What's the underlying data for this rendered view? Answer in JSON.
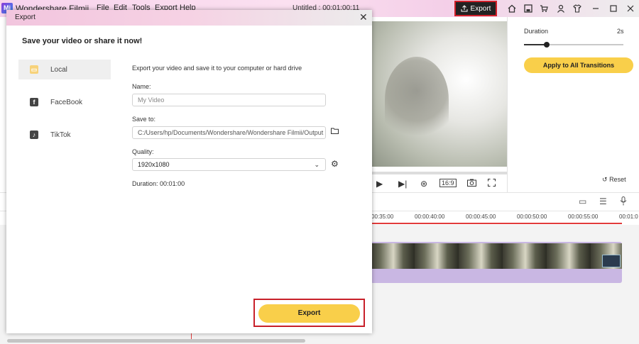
{
  "app": {
    "logo_text": "Mi",
    "name": "Wondershare Filmii",
    "menu": [
      "File",
      "Edit",
      "Tools",
      "Export",
      "Help"
    ],
    "doc_title": "Untitled : 00:01:00:11",
    "export_label": "Export"
  },
  "right_panel": {
    "duration_label": "Duration",
    "duration_value": "2s",
    "duration_fraction": 0.23,
    "apply_label": "Apply to All Transitions",
    "reset_label": "Reset"
  },
  "preview": {
    "ratio_label": "16:9"
  },
  "timeline": {
    "ticks": [
      "00:35:00",
      "00:00:40:00",
      "00:00:45:00",
      "00:00:50:00",
      "00:00:55:00",
      "00:01:0"
    ]
  },
  "dialog": {
    "title": "Export",
    "heading": "Save your video or share it now!",
    "destinations": [
      {
        "label": "Local",
        "icon": "folder-icon"
      },
      {
        "label": "FaceBook",
        "icon": "facebook-icon"
      },
      {
        "label": "TikTok",
        "icon": "tiktok-icon"
      }
    ],
    "description": "Export your video and save it to your computer or hard drive",
    "name_label": "Name:",
    "name_placeholder": "My Video",
    "save_to_label": "Save to:",
    "save_path": "C:/Users/hp/Documents/Wondershare/Wondershare Filmii/Output",
    "quality_label": "Quality:",
    "quality_value": "1920x1080",
    "duration_label": "Duration:",
    "duration_value": "00:01:00",
    "export_button": "Export"
  },
  "colors": {
    "accent_yellow": "#f9cf4a",
    "highlight_red": "#c8202a"
  }
}
